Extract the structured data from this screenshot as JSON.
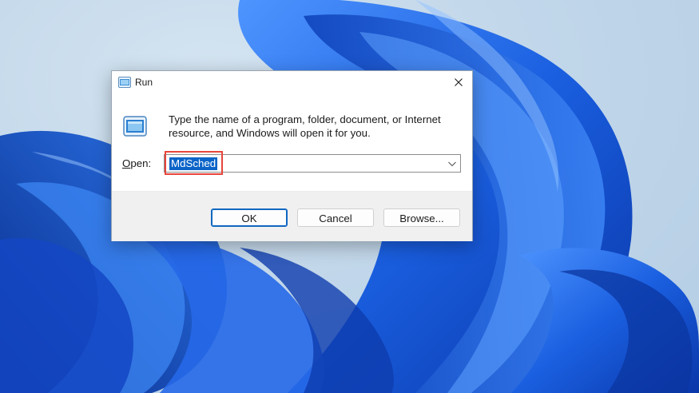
{
  "window": {
    "title": "Run",
    "title_icon": "run-app-icon",
    "close_icon": "close-icon"
  },
  "content": {
    "description": "Type the name of a program, folder, document, or Internet resource, and Windows will open it for you.",
    "open_label_mnemonic": "O",
    "open_label_rest": "pen:",
    "input_value": "MdSched",
    "dropdown_icon": "chevron-down-icon"
  },
  "buttons": {
    "ok": "OK",
    "cancel": "Cancel",
    "browse": "Browse..."
  },
  "colors": {
    "selection": "#0a64c8",
    "highlight_box": "#e8453c",
    "wallpaper_blue": "#1a5fe0"
  }
}
